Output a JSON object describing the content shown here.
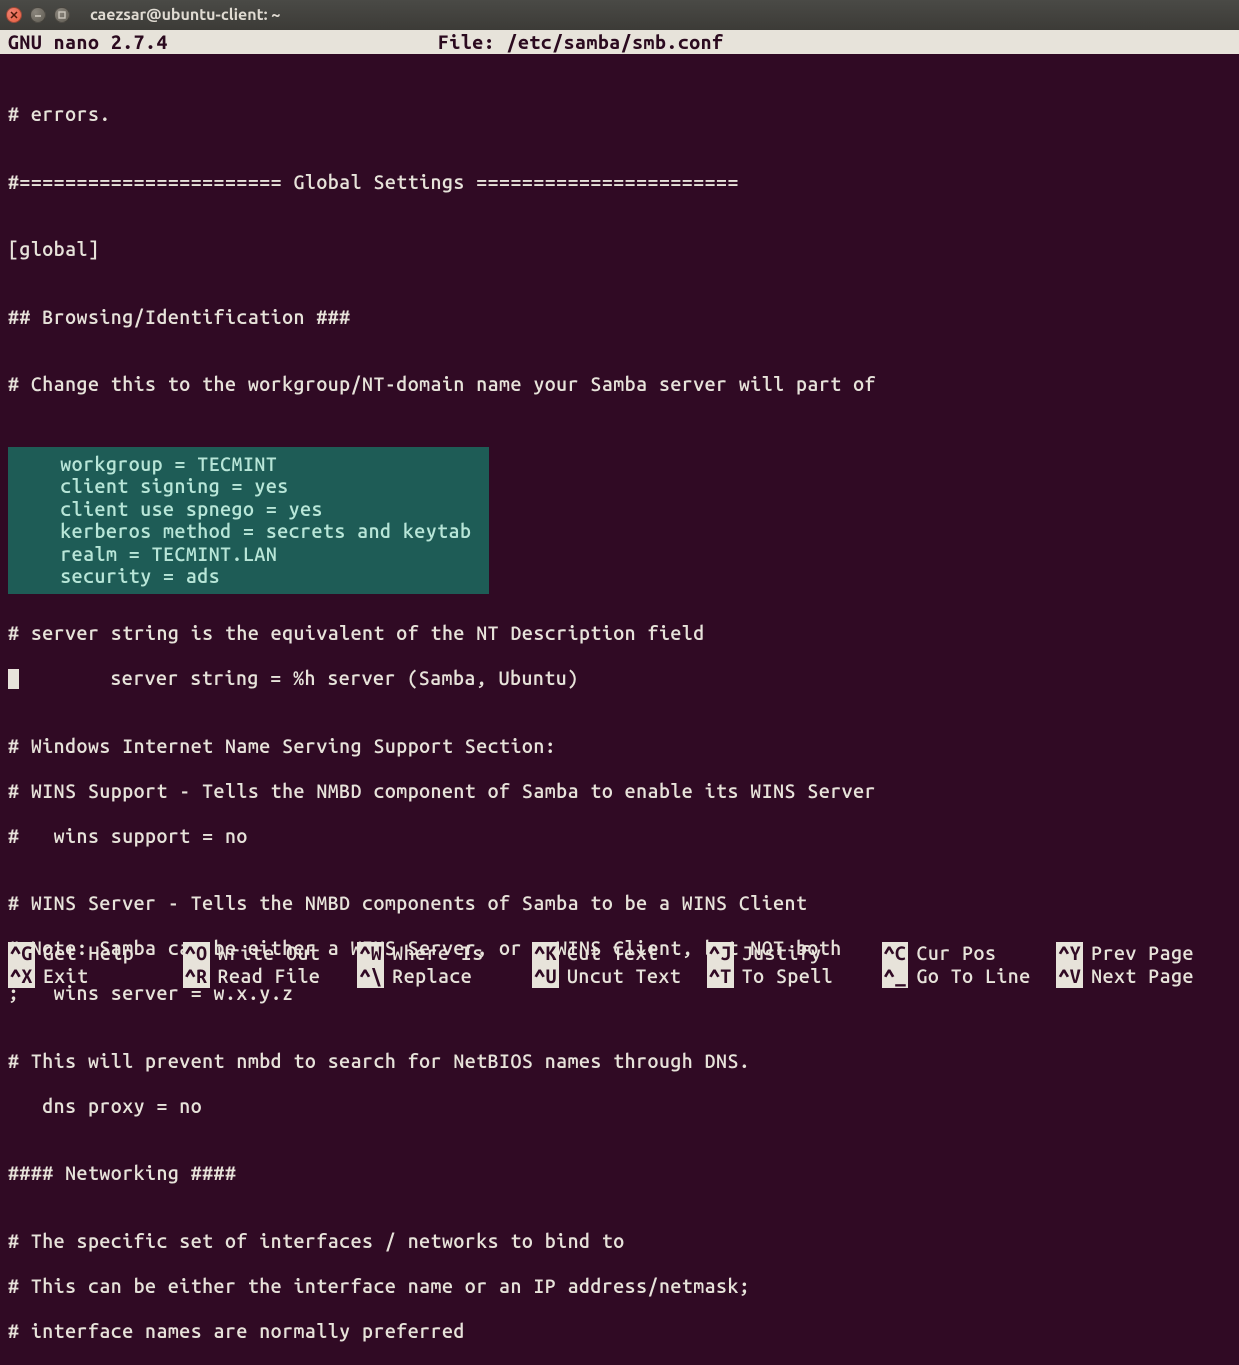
{
  "window": {
    "title": "caezsar@ubuntu-client: ~"
  },
  "nano": {
    "app_label": "  GNU nano 2.7.4",
    "file_label": "File:  /etc/samba/smb.conf"
  },
  "content": {
    "l1": "",
    "l2": "# errors.",
    "l3": "",
    "l4": "#======================= Global Settings =======================",
    "l5": "",
    "l6": "[global]",
    "l7": "",
    "l8": "## Browsing/Identification ###",
    "l9": "",
    "l10": "# Change this to the workgroup/NT-domain name your Samba server will part of",
    "l11": "",
    "hi1": "   workgroup = TECMINT",
    "hi2": "   client signing = yes",
    "hi3": "   client use spnego = yes",
    "hi4": "   kerberos method = secrets and keytab",
    "hi5": "   realm = TECMINT.LAN",
    "hi6": "   security = ads              ",
    "l12": "",
    "l13": "# server string is the equivalent of the NT Description field",
    "l14": "        server string = %h server (Samba, Ubuntu)",
    "l15": "",
    "l16": "# Windows Internet Name Serving Support Section:",
    "l17": "# WINS Support - Tells the NMBD component of Samba to enable its WINS Server",
    "l18": "#   wins support = no",
    "l19": "",
    "l20": "# WINS Server - Tells the NMBD components of Samba to be a WINS Client",
    "l21": "# Note: Samba can be either a WINS Server, or a WINS Client, but NOT both",
    "l22": ";   wins server = w.x.y.z",
    "l23": "",
    "l24": "# This will prevent nmbd to search for NetBIOS names through DNS.",
    "l25": "   dns proxy = no",
    "l26": "",
    "l27": "#### Networking ####",
    "l28": "",
    "l29": "# The specific set of interfaces / networks to bind to",
    "l30": "# This can be either the interface name or an IP address/netmask;",
    "l31": "# interface names are normally preferred"
  },
  "shortcuts": {
    "row1": [
      {
        "key": "^G",
        "label": "Get Help"
      },
      {
        "key": "^O",
        "label": "Write Out"
      },
      {
        "key": "^W",
        "label": "Where Is"
      },
      {
        "key": "^K",
        "label": "Cut Text"
      },
      {
        "key": "^J",
        "label": "Justify"
      },
      {
        "key": "^C",
        "label": "Cur Pos"
      },
      {
        "key": "^Y",
        "label": "Prev Page"
      }
    ],
    "row2": [
      {
        "key": "^X",
        "label": "Exit"
      },
      {
        "key": "^R",
        "label": "Read File"
      },
      {
        "key": "^\\",
        "label": "Replace"
      },
      {
        "key": "^U",
        "label": "Uncut Text"
      },
      {
        "key": "^T",
        "label": "To Spell"
      },
      {
        "key": "^_",
        "label": "Go To Line"
      },
      {
        "key": "^V",
        "label": "Next Page"
      }
    ]
  }
}
